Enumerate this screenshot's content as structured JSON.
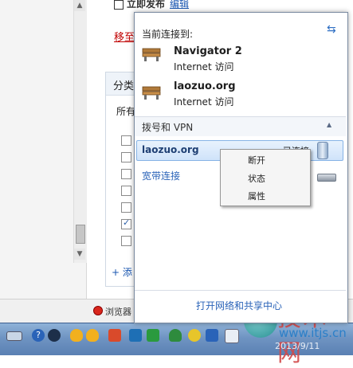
{
  "page": {
    "publish_label": "立即发布",
    "edit_link": "编辑",
    "move_link": "移至",
    "category_title": "分类",
    "category_all": "所有",
    "add_link": "+ 添",
    "browser_label": "浏览器"
  },
  "flyout": {
    "current_title": "当前连接到:",
    "connections": [
      {
        "name": "Navigator  2",
        "status": "Internet 访问"
      },
      {
        "name": "laozuo.org",
        "status": "Internet 访问"
      }
    ],
    "dialup_title": "拨号和 VPN",
    "vpn": {
      "name": "laozuo.org",
      "status": "已连接"
    },
    "broadband": "宽带连接",
    "open_center": "打开网络和共享中心"
  },
  "context_menu": {
    "items": [
      "断开",
      "状态",
      "属性"
    ]
  },
  "watermark": {
    "title": "技术网",
    "url": "www.itjs.cn",
    "date": "2013/9/11"
  },
  "colors": {
    "accent": "#2a63b8",
    "taskbar": "#6f94c2",
    "link_red": "#c00000"
  },
  "icons": {
    "network": "bench-network-icon",
    "refresh": "refresh-icon",
    "vpn": "vpn-device-icon",
    "broadband": "modem-icon"
  }
}
